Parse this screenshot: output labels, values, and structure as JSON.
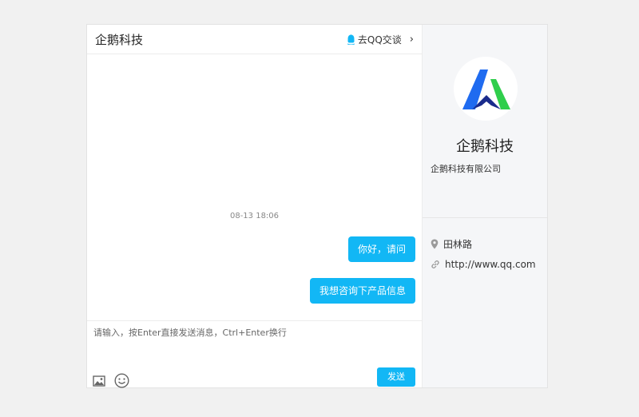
{
  "chat": {
    "title": "企鹅科技",
    "qq_link_label": "去QQ交谈",
    "qq_link_chevron": "›",
    "timestamp": "08-13 18:06",
    "messages": [
      {
        "text": "你好，请问"
      },
      {
        "text": "我想咨询下产品信息"
      }
    ],
    "input_placeholder": "请输入，按Enter直接发送消息，Ctrl+Enter换行",
    "send_label": "发送"
  },
  "profile": {
    "name": "企鹅科技",
    "full_name": "企鹅科技有限公司",
    "address": "田林路",
    "website": "http://www.qq.com"
  },
  "colors": {
    "accent": "#12b7f5",
    "logo_blue": "#1f6bf0",
    "logo_green": "#2fce4c",
    "logo_navy": "#1a2b8c"
  },
  "icons": {
    "qq": "penguin-icon",
    "image": "image-icon",
    "emoji": "emoji-icon",
    "location": "location-icon",
    "link": "link-icon"
  }
}
